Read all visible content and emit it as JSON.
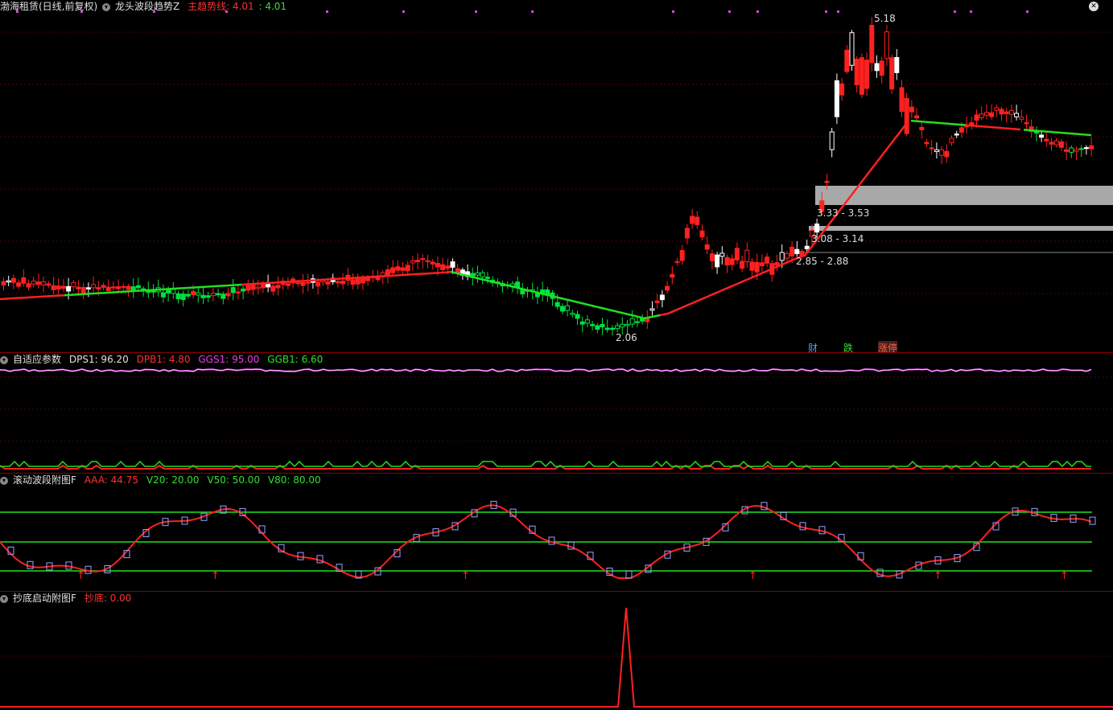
{
  "main": {
    "stock_name": "渤海租赁(日线,前复权)",
    "indicator_name": "龙头波段趋势Z",
    "trend_label": "主趋势线: 4.01",
    "trend_value": ": 4.01",
    "high_price": "5.18",
    "low_price": "2.06",
    "zone1": "3.33 - 3.53",
    "zone2": "3.08 - 3.14",
    "zone3": "2.85 - 2.88",
    "tag_cai": "财",
    "tag_die": "跌",
    "tag_zhangting": "涨停",
    "colors": {
      "up": "#ff2020",
      "down": "#00e040",
      "trend_up": "#ff2020",
      "trend_down": "#20e020",
      "zone": "#a0a0a0"
    }
  },
  "panel2": {
    "name": "自适应参数",
    "dps1": "DPS1: 96.20",
    "dpb1": "DPB1: 4.80",
    "ggs1": "GGS1: 95.00",
    "ggb1": "GGB1: 6.60"
  },
  "panel3": {
    "name": "滚动波段附图F",
    "aaa": "AAA: 44.75",
    "v20": "V20: 20.00",
    "v50": "V50: 50.00",
    "v80": "V80: 80.00"
  },
  "panel4": {
    "name": "抄底启动附图F",
    "chaodi": "抄底: 0.00"
  }
}
